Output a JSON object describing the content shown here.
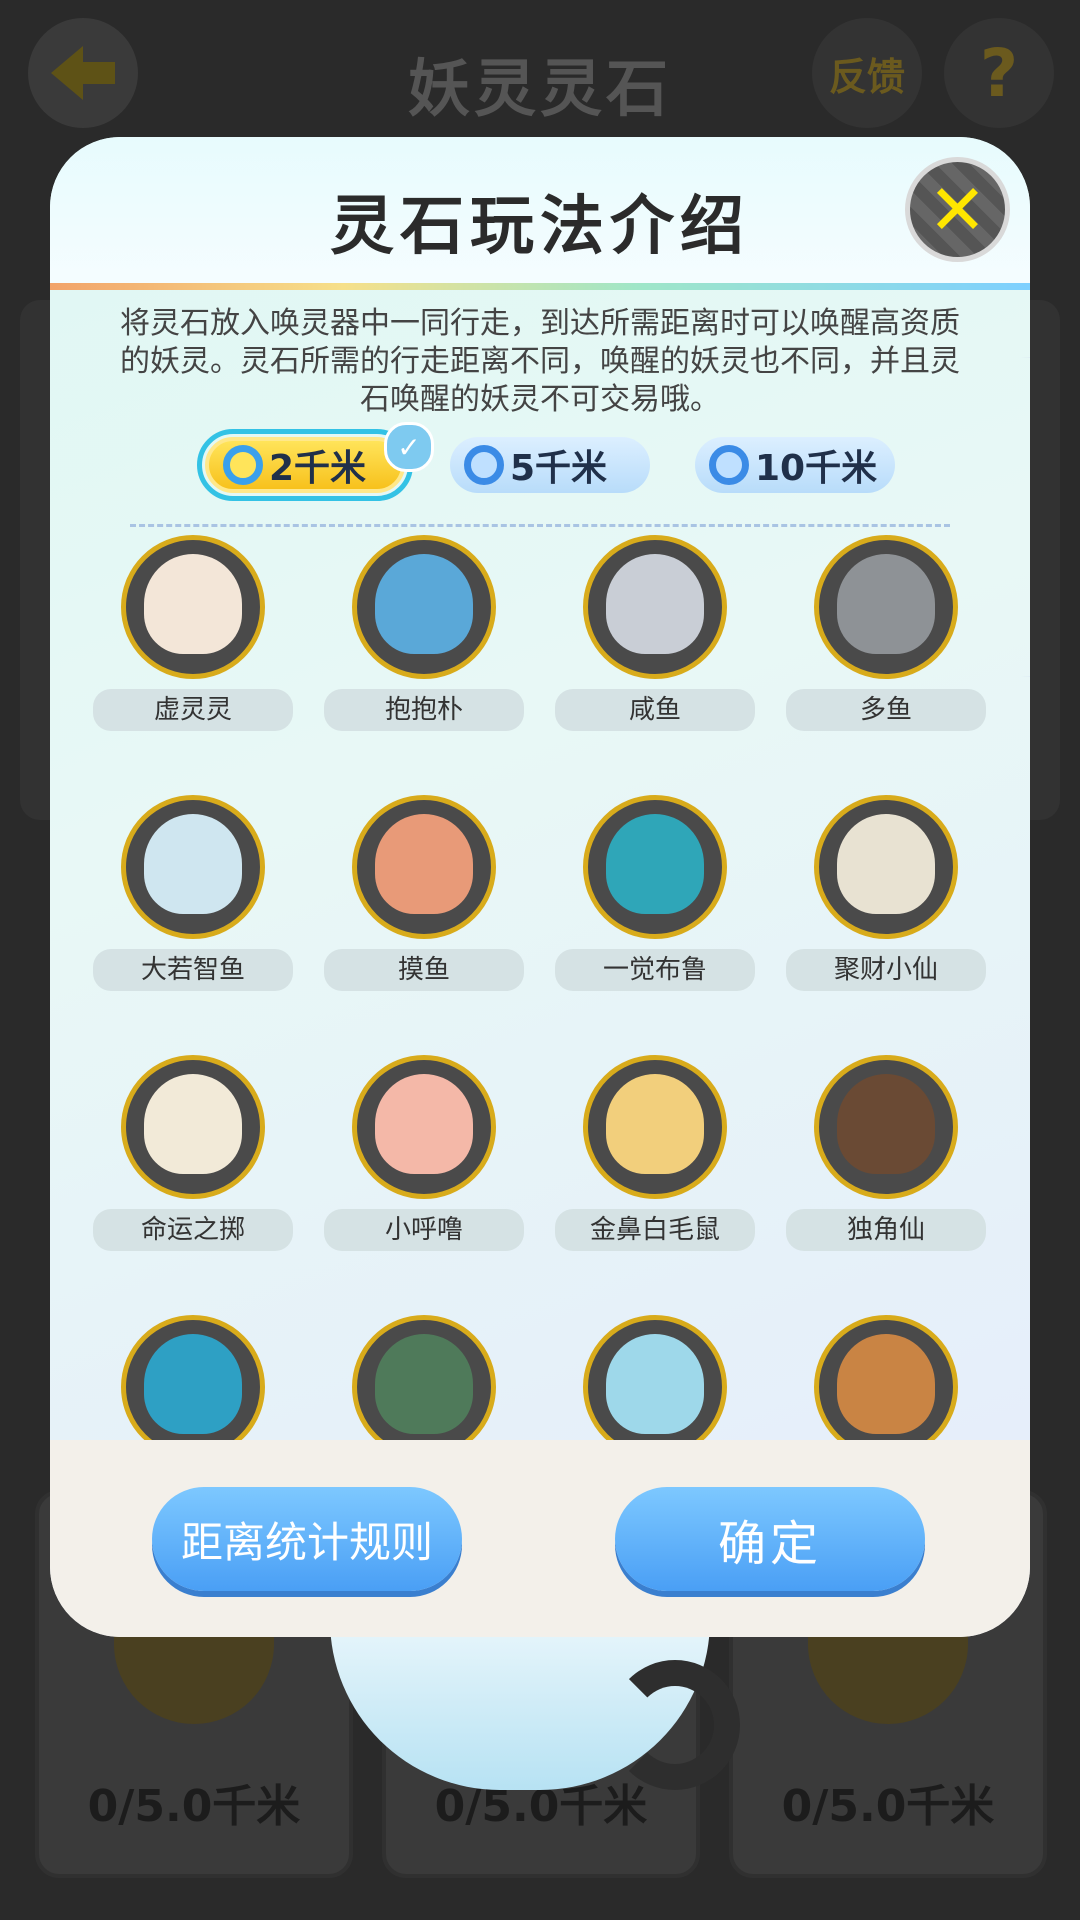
{
  "header": {
    "title": "妖灵灵石",
    "feedback_label": "反馈",
    "help_label": "?"
  },
  "background_cards": [
    {
      "distance": "0/5.0千米"
    },
    {
      "distance": "0/5.0千米"
    },
    {
      "distance": "0/5.0千米"
    }
  ],
  "modal": {
    "title": "灵石玩法介绍",
    "close_label": "✕",
    "intro": "将灵石放入唤灵器中一同行走，到达所需距离时可以唤醒高资质的妖灵。灵石所需的行走距离不同，唤醒的妖灵也不同，并且灵石唤醒的妖灵不可交易哦。",
    "tabs": [
      {
        "label": "2千米",
        "selected": true
      },
      {
        "label": "5千米",
        "selected": false
      },
      {
        "label": "10千米",
        "selected": false
      }
    ],
    "selected_check": "✓",
    "creatures": [
      {
        "name": "虚灵灵",
        "color": "#f3e6d8"
      },
      {
        "name": "抱抱朴",
        "color": "#5aa8d8"
      },
      {
        "name": "咸鱼",
        "color": "#c9ced6"
      },
      {
        "name": "多鱼",
        "color": "#8e9296"
      },
      {
        "name": "大若智鱼",
        "color": "#cfe6f0"
      },
      {
        "name": "摸鱼",
        "color": "#e89a78"
      },
      {
        "name": "一觉布鲁",
        "color": "#2fa6b8"
      },
      {
        "name": "聚财小仙",
        "color": "#e8e2d2"
      },
      {
        "name": "命运之掷",
        "color": "#f2ead8"
      },
      {
        "name": "小呼噜",
        "color": "#f4b8a8"
      },
      {
        "name": "金鼻白毛鼠",
        "color": "#f2cf7c"
      },
      {
        "name": "独角仙",
        "color": "#6a4a34"
      },
      {
        "name": "",
        "color": "#2ea0c4"
      },
      {
        "name": "",
        "color": "#4f7a5a"
      },
      {
        "name": "",
        "color": "#9ed8ea"
      },
      {
        "name": "",
        "color": "#c98444"
      }
    ],
    "buttons": {
      "rules_label": "距离统计规则",
      "ok_label": "确定"
    }
  }
}
